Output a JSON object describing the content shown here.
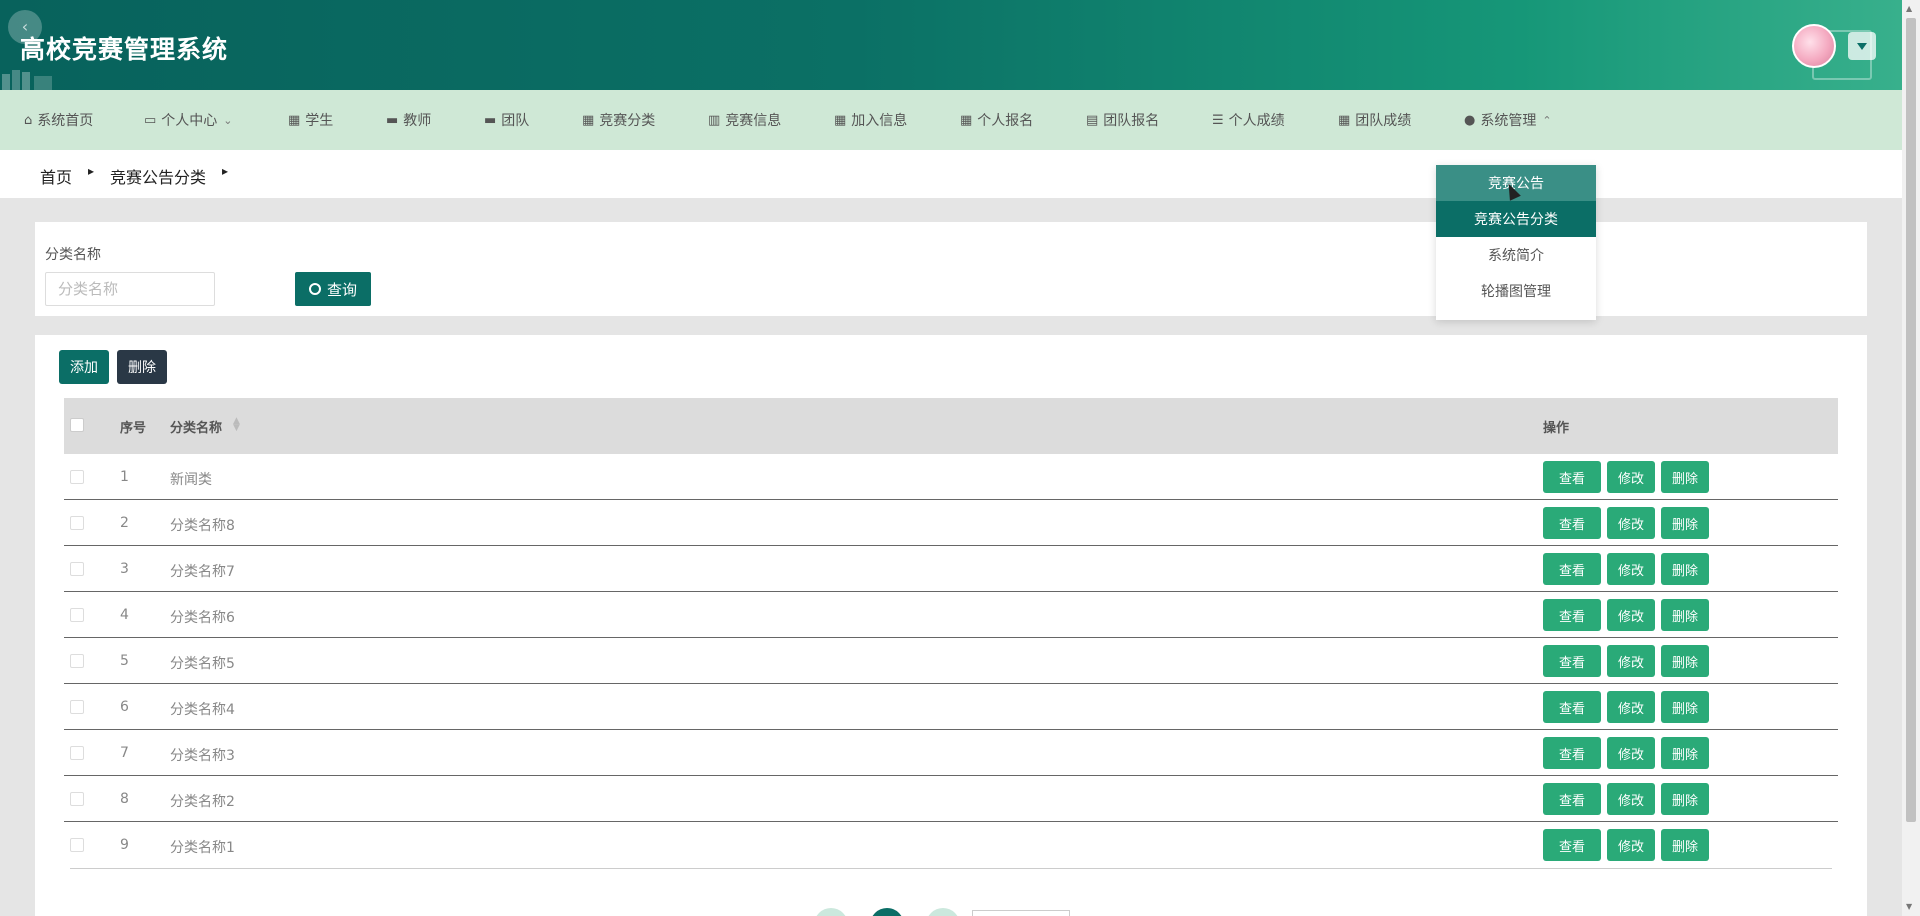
{
  "app": {
    "title": "高校竞赛管理系统"
  },
  "nav": {
    "items": [
      {
        "label": "系统首页",
        "icon": "home-icon"
      },
      {
        "label": "个人中心",
        "icon": "card-icon",
        "has_dropdown": true
      },
      {
        "label": "学生",
        "icon": "grid-icon"
      },
      {
        "label": "教师",
        "icon": "briefcase-icon"
      },
      {
        "label": "团队",
        "icon": "book-icon"
      },
      {
        "label": "竞赛分类",
        "icon": "grid-icon"
      },
      {
        "label": "竞赛信息",
        "icon": "books-icon"
      },
      {
        "label": "加入信息",
        "icon": "grid-icon"
      },
      {
        "label": "个人报名",
        "icon": "grid-icon"
      },
      {
        "label": "团队报名",
        "icon": "clipboard-icon"
      },
      {
        "label": "个人成绩",
        "icon": "list-icon"
      },
      {
        "label": "团队成绩",
        "icon": "grid-icon"
      },
      {
        "label": "系统管理",
        "icon": "user-icon",
        "has_dropdown": true,
        "expanded": true
      }
    ]
  },
  "breadcrumb": {
    "home": "首页",
    "current": "竞赛公告分类"
  },
  "search": {
    "label": "分类名称",
    "placeholder": "分类名称",
    "button": "查询"
  },
  "toolbar": {
    "add": "添加",
    "delete": "删除"
  },
  "table": {
    "headers": {
      "index": "序号",
      "name": "分类名称",
      "actions": "操作"
    },
    "rows": [
      {
        "index": "1",
        "name": "新闻类"
      },
      {
        "index": "2",
        "name": "分类名称8"
      },
      {
        "index": "3",
        "name": "分类名称7"
      },
      {
        "index": "4",
        "name": "分类名称6"
      },
      {
        "index": "5",
        "name": "分类名称5"
      },
      {
        "index": "6",
        "name": "分类名称4"
      },
      {
        "index": "7",
        "name": "分类名称3"
      },
      {
        "index": "8",
        "name": "分类名称2"
      },
      {
        "index": "9",
        "name": "分类名称1"
      }
    ],
    "row_actions": {
      "view": "查看",
      "edit": "修改",
      "delete": "删除"
    }
  },
  "dropdown": {
    "items": [
      {
        "label": "竞赛公告",
        "state": "hover"
      },
      {
        "label": "竞赛公告分类",
        "state": "active"
      },
      {
        "label": "系统简介",
        "state": "normal"
      },
      {
        "label": "轮播图管理",
        "state": "normal"
      }
    ]
  },
  "colors": {
    "primary": "#0b6e66",
    "action_green": "#2aaa78",
    "nav_bg": "#cfe8d6",
    "dark_button": "#2a3846"
  }
}
